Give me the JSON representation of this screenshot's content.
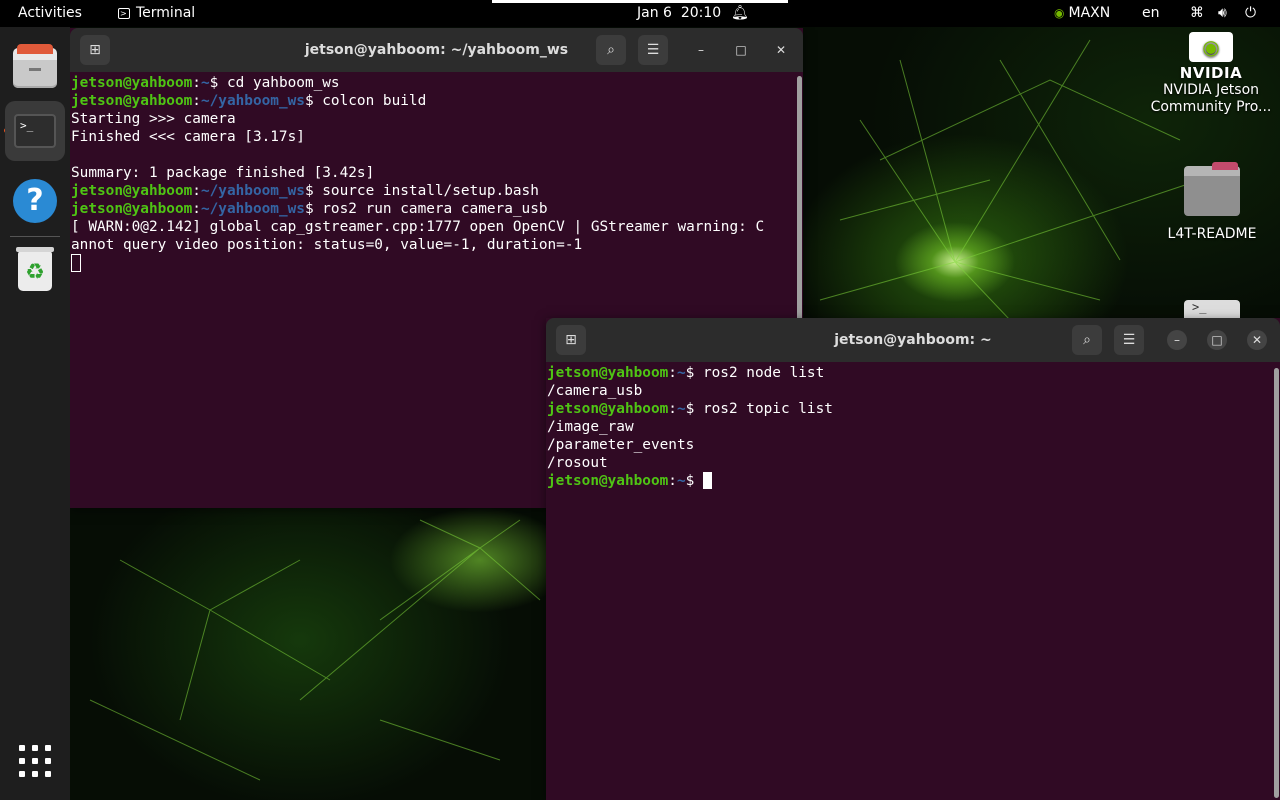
{
  "topbar": {
    "activities": "Activities",
    "app_name": "Terminal",
    "app_icon": "terminal-icon",
    "date": "Jan 6",
    "time": "20:10",
    "notification_icon": "bell-icon",
    "power_mode": "MAXN",
    "power_mode_icon": "nvidia-icon",
    "language": "en",
    "network_icon": "network-icon",
    "volume_icon": "volume-icon",
    "power_icon": "power-icon"
  },
  "dock": {
    "items": [
      {
        "name": "Files",
        "icon": "files-icon"
      },
      {
        "name": "Terminal",
        "icon": "terminal-icon",
        "running": true
      },
      {
        "name": "Help",
        "icon": "help-icon",
        "glyph": "?"
      },
      {
        "name": "Trash",
        "icon": "trash-icon",
        "glyph": "♻"
      }
    ],
    "apps_icon": "show-apps-icon"
  },
  "desktop": {
    "nvidia": {
      "brand": "NVIDIA",
      "label_line1": "NVIDIA Jetson",
      "label_line2": "Community Pro..."
    },
    "readme": {
      "label": "L4T-README"
    },
    "peek_glyph": ">_"
  },
  "windows": [
    {
      "title": "jetson@yahboom: ~/yahboom_ws",
      "new_tab_icon": "new-tab-icon",
      "search_icon": "search-icon",
      "menu_icon": "hamburger-menu-icon",
      "minimize": "–",
      "maximize": "□",
      "close": "✕",
      "lines": [
        {
          "user": "jetson@yahboom",
          "sep": ":",
          "path": "~",
          "prompt": "$ ",
          "cmd": "cd yahboom_ws"
        },
        {
          "user": "jetson@yahboom",
          "sep": ":",
          "path": "~/yahboom_ws",
          "prompt": "$ ",
          "cmd": "colcon build"
        },
        {
          "text": "Starting >>> camera"
        },
        {
          "text": "Finished <<< camera [3.17s]"
        },
        {
          "text": ""
        },
        {
          "text": "Summary: 1 package finished [3.42s]"
        },
        {
          "user": "jetson@yahboom",
          "sep": ":",
          "path": "~/yahboom_ws",
          "prompt": "$ ",
          "cmd": "source install/setup.bash"
        },
        {
          "user": "jetson@yahboom",
          "sep": ":",
          "path": "~/yahboom_ws",
          "prompt": "$ ",
          "cmd": "ros2 run camera camera_usb"
        },
        {
          "text": "[ WARN:0@2.142] global cap_gstreamer.cpp:1777 open OpenCV | GStreamer warning: C"
        },
        {
          "text": "annot query video position: status=0, value=-1, duration=-1"
        }
      ]
    },
    {
      "title": "jetson@yahboom: ~",
      "new_tab_icon": "new-tab-icon",
      "search_icon": "search-icon",
      "menu_icon": "hamburger-menu-icon",
      "minimize": "–",
      "maximize": "□",
      "close": "✕",
      "lines": [
        {
          "user": "jetson@yahboom",
          "sep": ":",
          "path": "~",
          "prompt": "$ ",
          "cmd": "ros2 node list"
        },
        {
          "text": "/camera_usb"
        },
        {
          "user": "jetson@yahboom",
          "sep": ":",
          "path": "~",
          "prompt": "$ ",
          "cmd": "ros2 topic list"
        },
        {
          "text": "/image_raw"
        },
        {
          "text": "/parameter_events"
        },
        {
          "text": "/rosout"
        },
        {
          "user": "jetson@yahboom",
          "sep": ":",
          "path": "~",
          "prompt": "$ ",
          "cmd": ""
        }
      ]
    }
  ]
}
